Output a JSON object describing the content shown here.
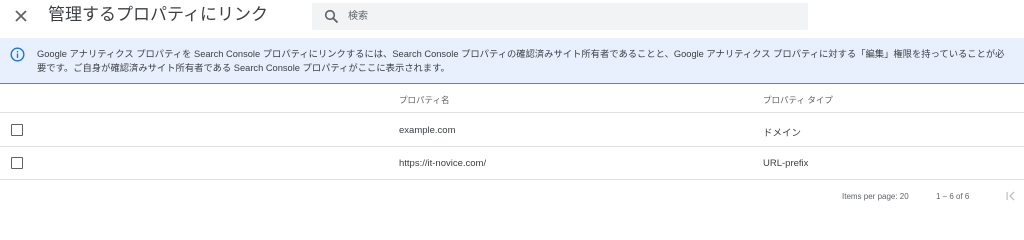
{
  "header": {
    "close_icon": "close-icon",
    "title": "管理するプロパティにリンク",
    "search": {
      "placeholder": "検索",
      "value": "",
      "icon": "search-icon"
    }
  },
  "banner": {
    "icon": "info-icon",
    "accent_color": "#1a73e8",
    "background": "#e8f0fe",
    "text": "Google アナリティクス プロパティを Search Console プロパティにリンクするには、Search Console プロパティの確認済みサイト所有者であることと、Google アナリティクス プロパティに対する「編集」権限を持っていることが必要です。ご自身が確認済みサイト所有者である Search Console プロパティがここに表示されます。"
  },
  "table": {
    "columns": [
      "プロパティ名",
      "プロパティ タイプ"
    ],
    "rows": [
      {
        "name": "example.com",
        "type": "ドメイン",
        "checked": false
      },
      {
        "name": "https://it-novice.com/",
        "type": "URL-prefix",
        "checked": false
      }
    ]
  },
  "paginator": {
    "items_per_page_label": "Items per page: 20",
    "range_label": "1 – 6 of 6",
    "first_page_icon": "first-page-icon"
  }
}
